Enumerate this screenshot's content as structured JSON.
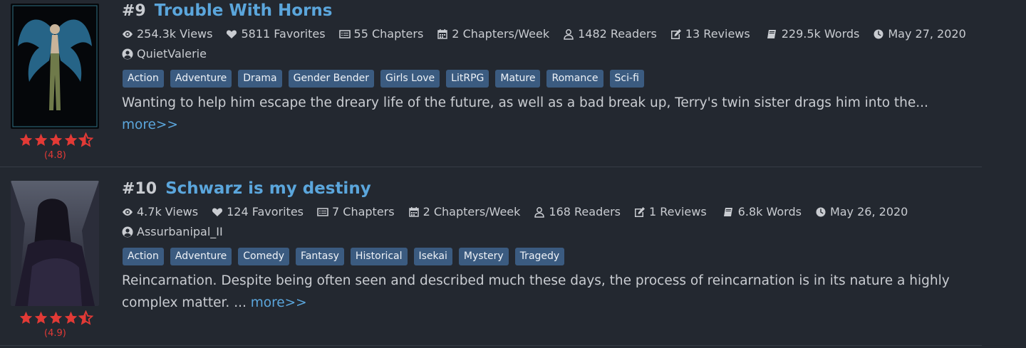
{
  "entries": [
    {
      "rank": "#9",
      "title": "Trouble With Horns",
      "rating": "(4.8)",
      "rating_value": 4.8,
      "stats": {
        "views": "254.3k Views",
        "favorites": "5811 Favorites",
        "chapters": "55 Chapters",
        "rate": "2 Chapters/Week",
        "readers": "1482 Readers",
        "reviews": "13 Reviews",
        "words": "229.5k Words",
        "date": "May 27, 2020"
      },
      "author": "QuietValerie",
      "tags": [
        "Action",
        "Adventure",
        "Drama",
        "Gender Bender",
        "Girls Love",
        "LitRPG",
        "Mature",
        "Romance",
        "Sci-fi"
      ],
      "description": "Wanting to help him escape the dreary life of the future, as well as a bad break up, Terry's twin sister drags him into the...",
      "more": "more>>"
    },
    {
      "rank": "#10",
      "title": "Schwarz is my destiny",
      "rating": "(4.9)",
      "rating_value": 4.9,
      "stats": {
        "views": "4.7k Views",
        "favorites": "124 Favorites",
        "chapters": "7 Chapters",
        "rate": "2 Chapters/Week",
        "readers": "168 Readers",
        "reviews": "1 Reviews",
        "words": "6.8k Words",
        "date": "May 26, 2020"
      },
      "author": "Assurbanipal_II",
      "tags": [
        "Action",
        "Adventure",
        "Comedy",
        "Fantasy",
        "Historical",
        "Isekai",
        "Mystery",
        "Tragedy"
      ],
      "description": "Reincarnation. Despite being often seen and described much these days, the process of reincarnation is in its nature a highly complex matter. ...",
      "more": "more>>"
    }
  ],
  "colors": {
    "background": "#232830",
    "link": "#5ba6dc",
    "tag_bg": "#3b5b80",
    "star": "#e23a36",
    "text": "#c9ccd1"
  },
  "icons": [
    "eye-icon",
    "heart-icon",
    "list-icon",
    "calendar-icon",
    "user-icon",
    "edit-icon",
    "book-icon",
    "clock-icon",
    "user-circle-icon",
    "star-icon"
  ]
}
